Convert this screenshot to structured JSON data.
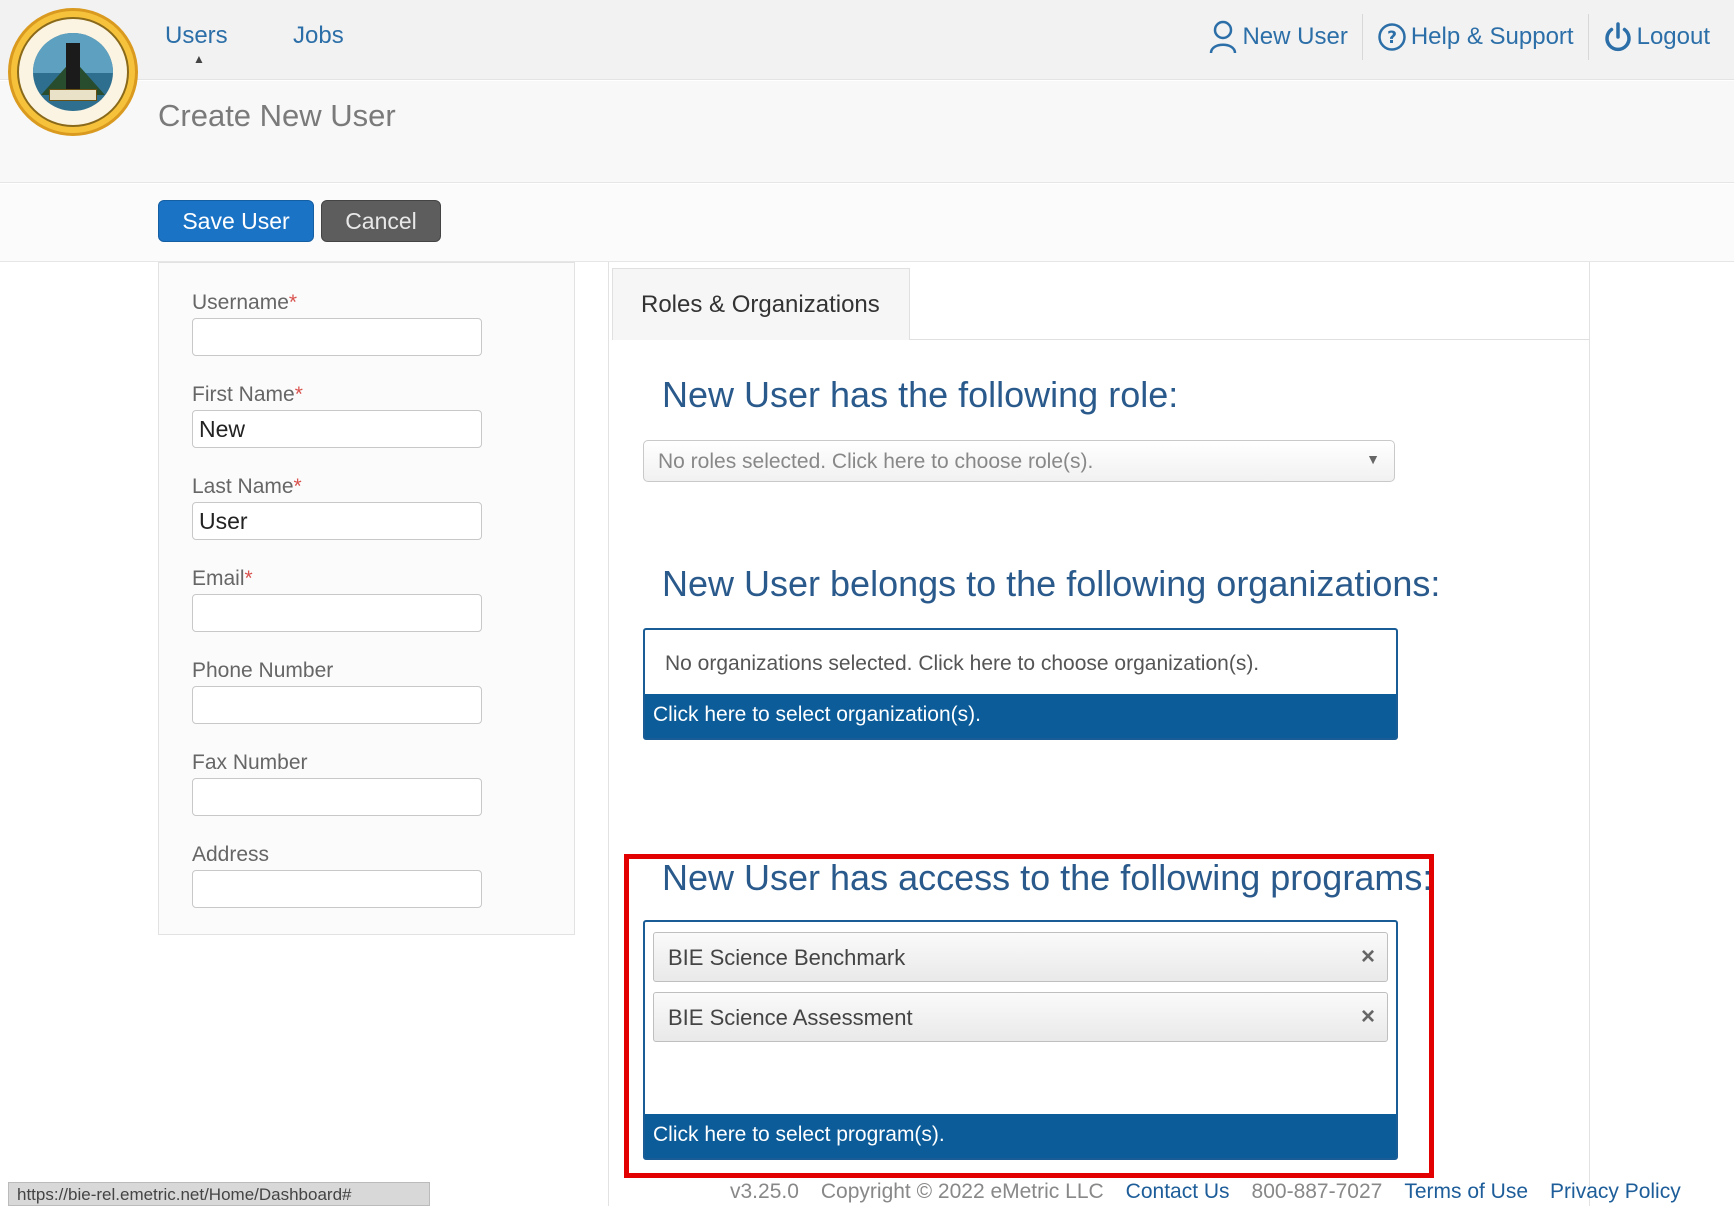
{
  "header": {
    "nav": [
      {
        "label": "Users"
      },
      {
        "label": "Jobs"
      }
    ],
    "right": [
      {
        "label": "New User",
        "icon": "user-icon"
      },
      {
        "label": "Help & Support",
        "icon": "help-icon"
      },
      {
        "label": "Logout",
        "icon": "power-icon"
      }
    ]
  },
  "page": {
    "title": "Create New User"
  },
  "toolbar": {
    "save_label": "Save User",
    "cancel_label": "Cancel"
  },
  "form": {
    "username": {
      "label": "Username",
      "value": ""
    },
    "first_name": {
      "label": "First Name",
      "value": "New"
    },
    "last_name": {
      "label": "Last Name",
      "value": "User"
    },
    "email": {
      "label": "Email",
      "value": ""
    },
    "phone": {
      "label": "Phone Number",
      "value": ""
    },
    "fax": {
      "label": "Fax Number",
      "value": ""
    },
    "address": {
      "label": "Address",
      "value": ""
    },
    "required_mark": "*"
  },
  "tab": {
    "label": "Roles & Organizations"
  },
  "roles": {
    "heading": "New User has the following role:",
    "placeholder": "No roles selected. Click here to choose role(s).",
    "arrow": "▼"
  },
  "orgs": {
    "heading": "New User belongs to the following organizations:",
    "empty_msg": "No organizations selected.  Click here to choose organization(s).",
    "select_bar": "Click here to select organization(s)."
  },
  "programs": {
    "heading": "New User has access to the following programs:",
    "items": [
      {
        "label": "BIE Science Benchmark"
      },
      {
        "label": "BIE Science Assessment"
      }
    ],
    "remove_glyph": "×",
    "select_bar": "Click here to select program(s)."
  },
  "footer": {
    "status_url": "https://bie-rel.emetric.net/Home/Dashboard#",
    "version": "v3.25.0",
    "copyright": "Copyright © 2022 eMetric LLC",
    "contact": "Contact Us",
    "phone": "800-887-7027",
    "terms": "Terms of Use",
    "privacy": "Privacy Policy"
  },
  "colors": {
    "accent_blue": "#1b73c6",
    "bar_blue": "#0b5c99",
    "highlight_red": "#e30000"
  }
}
